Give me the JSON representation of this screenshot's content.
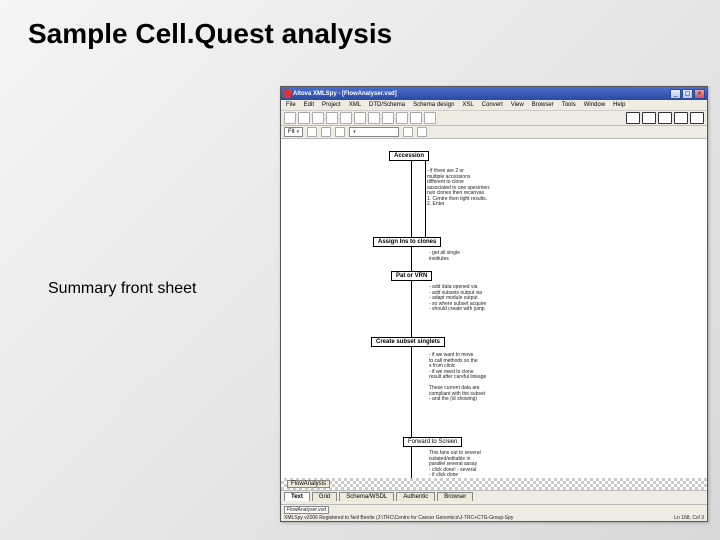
{
  "page": {
    "title": "Sample Cell.Quest analysis",
    "caption": "Summary front sheet"
  },
  "window": {
    "title": "Altova XMLSpy - [FlowAnalyser.vsd]",
    "menu": [
      "File",
      "Edit",
      "Project",
      "XML",
      "DTD/Schema",
      "Schema design",
      "XSL",
      "Convert",
      "View",
      "Browser",
      "Tools",
      "Window",
      "Help"
    ],
    "dropdowns": {
      "d1": "Fit",
      "d2": " "
    },
    "boxes": {
      "accession": "Accession",
      "assign": "Assign Ins to clones",
      "patvrn": "Pat or VRN",
      "create": "Create subset singlets",
      "forward": "Forward to Screen",
      "flow": "FlowAnalysis"
    },
    "notes": {
      "n1": "- if there are 2 or\nmultiple accessions\ndifferent to clone\nassociated to one specimen:\nnun clones then recanvas\n1. Centre then tight results.\n2. Enter",
      "n2": "- get all single\ninstitutes",
      "n3": "- add data opened via\n- add subsets output via\n- adapt module output\n- so where subset acquire\n- should create with jump",
      "n4": "- if we want to move\nto call methods so the\nx from clinic\n- if we need to clone\nresult after careful linkage\n\nThese current data are\ncompliant with the subset\n- and the (id showing)",
      "n5": "This fans out to several\nisolated/editable in\nparallel several assay\n- click done! - several\n- if click done"
    },
    "tabs": [
      "Text",
      "Grid",
      "Schema/WSDL",
      "Authentic",
      "Browser"
    ],
    "active_tab": 0,
    "filter": "FlowAnalyser.vsd",
    "statusbar": "XMLSpy v2006 Registered to Neil Bentle (J:\\TRC\\Centre for Cancer Genomics\\J-TRC+CTG-Group-Spy",
    "status_right": "Ln 168, Col 3"
  }
}
